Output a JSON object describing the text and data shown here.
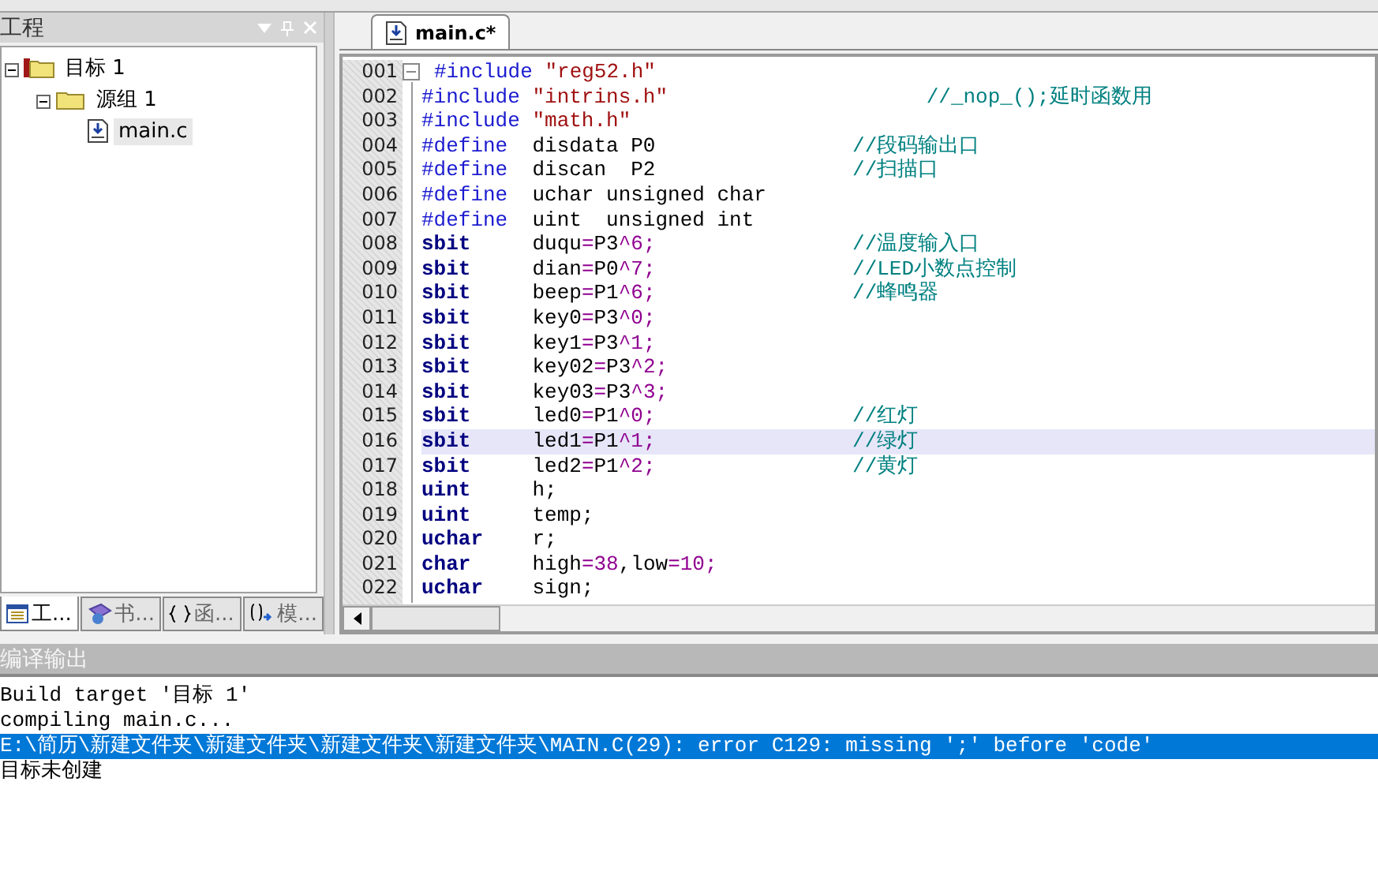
{
  "project_panel": {
    "title": "工程",
    "tree": [
      {
        "label": "目标 1",
        "expanded": true,
        "selected": false,
        "children": [
          {
            "label": "源组 1",
            "expanded": true,
            "selected": false,
            "children": [
              {
                "label": "main.c",
                "selected": true
              }
            ]
          }
        ]
      }
    ],
    "tabs": [
      {
        "label": "工...",
        "selected": true
      },
      {
        "label": "书...",
        "selected": false
      },
      {
        "label": "函...",
        "selected": false
      },
      {
        "label": "模...",
        "selected": false
      }
    ]
  },
  "editor": {
    "tabs": [
      {
        "label": "main.c*",
        "selected": true
      }
    ],
    "lines": [
      {
        "number": "001",
        "current": false,
        "segments": [
          {
            "kind": "directive",
            "text": "#include"
          },
          {
            "kind": "string",
            "text": "\"reg52.h\""
          }
        ]
      },
      {
        "number": "002",
        "current": false,
        "segments": [
          {
            "kind": "directive",
            "text": "#include"
          },
          {
            "kind": "string",
            "text": "\"intrins.h\""
          }
        ],
        "comment": "//_nop_();延时函数用"
      },
      {
        "number": "003",
        "current": false,
        "segments": [
          {
            "kind": "directive",
            "text": "#include"
          },
          {
            "kind": "string",
            "text": "\"math.h\""
          }
        ]
      },
      {
        "number": "004",
        "current": false,
        "segments": [
          {
            "kind": "directive",
            "text": "#define"
          },
          {
            "kind": "plain",
            "text": "  disdata P0"
          }
        ],
        "comment": "//段码输出口"
      },
      {
        "number": "005",
        "current": false,
        "segments": [
          {
            "kind": "directive",
            "text": "#define"
          },
          {
            "kind": "plain",
            "text": "  discan  P2"
          }
        ],
        "comment": "//扫描口"
      },
      {
        "number": "006",
        "current": false,
        "segments": [
          {
            "kind": "directive",
            "text": "#define"
          },
          {
            "kind": "plain",
            "text": "  uchar unsigned char"
          }
        ]
      },
      {
        "number": "007",
        "current": false,
        "segments": [
          {
            "kind": "directive",
            "text": "#define"
          },
          {
            "kind": "plain",
            "text": "  uint  unsigned int"
          }
        ]
      },
      {
        "number": "008",
        "current": false,
        "segments": [
          {
            "kind": "keyword",
            "text": "sbit"
          },
          {
            "kind": "plain",
            "text": "     duqu"
          },
          {
            "kind": "number",
            "text": "="
          },
          {
            "kind": "plain",
            "text": "P3"
          },
          {
            "kind": "number",
            "text": "^6;"
          }
        ],
        "comment": "//温度输入口"
      },
      {
        "number": "009",
        "current": false,
        "segments": [
          {
            "kind": "keyword",
            "text": "sbit"
          },
          {
            "kind": "plain",
            "text": "     dian"
          },
          {
            "kind": "number",
            "text": "="
          },
          {
            "kind": "plain",
            "text": "P0"
          },
          {
            "kind": "number",
            "text": "^7;"
          }
        ],
        "comment": "//LED小数点控制"
      },
      {
        "number": "010",
        "current": false,
        "segments": [
          {
            "kind": "keyword",
            "text": "sbit"
          },
          {
            "kind": "plain",
            "text": "     beep"
          },
          {
            "kind": "number",
            "text": "="
          },
          {
            "kind": "plain",
            "text": "P1"
          },
          {
            "kind": "number",
            "text": "^6;"
          }
        ],
        "comment": "//蜂鸣器"
      },
      {
        "number": "011",
        "current": false,
        "segments": [
          {
            "kind": "keyword",
            "text": "sbit"
          },
          {
            "kind": "plain",
            "text": "     key0"
          },
          {
            "kind": "number",
            "text": "="
          },
          {
            "kind": "plain",
            "text": "P3"
          },
          {
            "kind": "number",
            "text": "^0;"
          }
        ]
      },
      {
        "number": "012",
        "current": false,
        "segments": [
          {
            "kind": "keyword",
            "text": "sbit"
          },
          {
            "kind": "plain",
            "text": "     key1"
          },
          {
            "kind": "number",
            "text": "="
          },
          {
            "kind": "plain",
            "text": "P3"
          },
          {
            "kind": "number",
            "text": "^1;"
          }
        ]
      },
      {
        "number": "013",
        "current": false,
        "segments": [
          {
            "kind": "keyword",
            "text": "sbit"
          },
          {
            "kind": "plain",
            "text": "     key02"
          },
          {
            "kind": "number",
            "text": "="
          },
          {
            "kind": "plain",
            "text": "P3"
          },
          {
            "kind": "number",
            "text": "^2;"
          }
        ]
      },
      {
        "number": "014",
        "current": false,
        "segments": [
          {
            "kind": "keyword",
            "text": "sbit"
          },
          {
            "kind": "plain",
            "text": "     key03"
          },
          {
            "kind": "number",
            "text": "="
          },
          {
            "kind": "plain",
            "text": "P3"
          },
          {
            "kind": "number",
            "text": "^3;"
          }
        ]
      },
      {
        "number": "015",
        "current": false,
        "segments": [
          {
            "kind": "keyword",
            "text": "sbit"
          },
          {
            "kind": "plain",
            "text": "     led0"
          },
          {
            "kind": "number",
            "text": "="
          },
          {
            "kind": "plain",
            "text": "P1"
          },
          {
            "kind": "number",
            "text": "^0;"
          }
        ],
        "comment": "//红灯"
      },
      {
        "number": "016",
        "current": true,
        "segments": [
          {
            "kind": "keyword",
            "text": "sbit"
          },
          {
            "kind": "plain",
            "text": "     led1"
          },
          {
            "kind": "number",
            "text": "="
          },
          {
            "kind": "plain",
            "text": "P1"
          },
          {
            "kind": "number",
            "text": "^1;"
          }
        ],
        "comment": "//绿灯"
      },
      {
        "number": "017",
        "current": false,
        "segments": [
          {
            "kind": "keyword",
            "text": "sbit"
          },
          {
            "kind": "plain",
            "text": "     led2"
          },
          {
            "kind": "number",
            "text": "="
          },
          {
            "kind": "plain",
            "text": "P1"
          },
          {
            "kind": "number",
            "text": "^2;"
          }
        ],
        "comment": "//黄灯"
      },
      {
        "number": "018",
        "current": false,
        "segments": [
          {
            "kind": "keyword",
            "text": "uint"
          },
          {
            "kind": "plain",
            "text": "     h;"
          }
        ]
      },
      {
        "number": "019",
        "current": false,
        "segments": [
          {
            "kind": "keyword",
            "text": "uint"
          },
          {
            "kind": "plain",
            "text": "     temp;"
          }
        ]
      },
      {
        "number": "020",
        "current": false,
        "segments": [
          {
            "kind": "keyword",
            "text": "uchar"
          },
          {
            "kind": "plain",
            "text": "    r;"
          }
        ]
      },
      {
        "number": "021",
        "current": false,
        "segments": [
          {
            "kind": "keyword",
            "text": "char"
          },
          {
            "kind": "plain",
            "text": "     high"
          },
          {
            "kind": "number",
            "text": "=38"
          },
          {
            "kind": "plain",
            "text": ",low"
          },
          {
            "kind": "number",
            "text": "=10;"
          }
        ]
      },
      {
        "number": "022",
        "current": false,
        "segments": [
          {
            "kind": "keyword",
            "text": "uchar"
          },
          {
            "kind": "plain",
            "text": "    sign;"
          }
        ]
      }
    ]
  },
  "output": {
    "title": "编译输出",
    "lines": [
      {
        "text": "Build target '目标 1'",
        "selected": false
      },
      {
        "text": "compiling main.c...",
        "selected": false
      },
      {
        "text": "E:\\简历\\新建文件夹\\新建文件夹\\新建文件夹\\新建文件夹\\MAIN.C(29): error C129: missing ';' before 'code'",
        "selected": true
      },
      {
        "text": "目标未创建",
        "selected": false
      }
    ]
  }
}
